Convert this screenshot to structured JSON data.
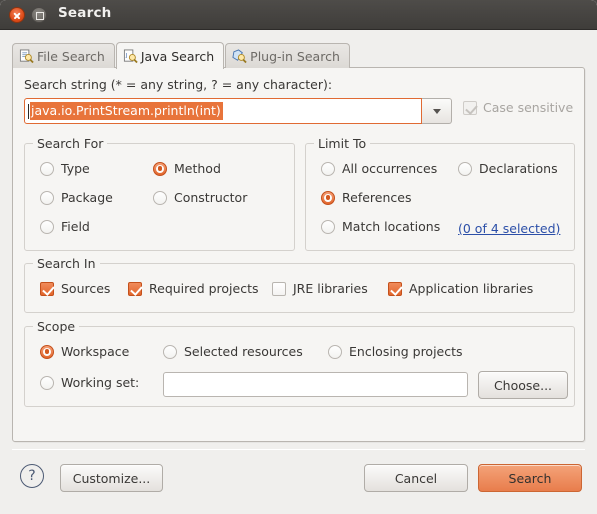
{
  "window": {
    "title": "Search",
    "close_label": "Close",
    "maximize_label": "Maximize"
  },
  "tabs": [
    {
      "label": "File Search",
      "icon": "file-search-icon",
      "active": false
    },
    {
      "label": "Java Search",
      "icon": "java-search-icon",
      "active": true
    },
    {
      "label": "Plug-in Search",
      "icon": "plugin-search-icon",
      "active": false
    }
  ],
  "search_string": {
    "label": "Search string (* = any string, ? = any character):",
    "value": "java.io.PrintStream.println(int)",
    "selected": true,
    "dropdown_icon": "chevron-down-icon"
  },
  "case_sensitive": {
    "label": "Case sensitive",
    "checked": true,
    "enabled": false
  },
  "search_for": {
    "title": "Search For",
    "options": [
      {
        "label": "Type",
        "selected": false
      },
      {
        "label": "Method",
        "selected": true
      },
      {
        "label": "Package",
        "selected": false
      },
      {
        "label": "Constructor",
        "selected": false
      },
      {
        "label": "Field",
        "selected": false
      }
    ]
  },
  "limit_to": {
    "title": "Limit To",
    "options": [
      {
        "label": "All occurrences",
        "selected": false
      },
      {
        "label": "Declarations",
        "selected": false
      },
      {
        "label": "References",
        "selected": true
      },
      {
        "label": "Match locations",
        "selected": false
      }
    ],
    "match_locations_link": "(0 of 4 selected)"
  },
  "search_in": {
    "title": "Search In",
    "options": [
      {
        "label": "Sources",
        "checked": true
      },
      {
        "label": "Required projects",
        "checked": true
      },
      {
        "label": "JRE libraries",
        "checked": false
      },
      {
        "label": "Application libraries",
        "checked": true
      }
    ]
  },
  "scope": {
    "title": "Scope",
    "options": [
      {
        "label": "Workspace",
        "selected": true
      },
      {
        "label": "Selected resources",
        "selected": false
      },
      {
        "label": "Enclosing projects",
        "selected": false
      },
      {
        "label": "Working set:",
        "selected": false
      }
    ],
    "working_set_value": "",
    "choose_label": "Choose..."
  },
  "footer": {
    "help_icon": "help-question-icon",
    "customize_label": "Customize...",
    "cancel_label": "Cancel",
    "search_label": "Search"
  },
  "colors": {
    "accent": "#e8743b",
    "titlebar": "#45433f",
    "dialog_bg": "#f0efed",
    "panel_bg": "#f6f5f3",
    "link": "#2c4fa8"
  }
}
